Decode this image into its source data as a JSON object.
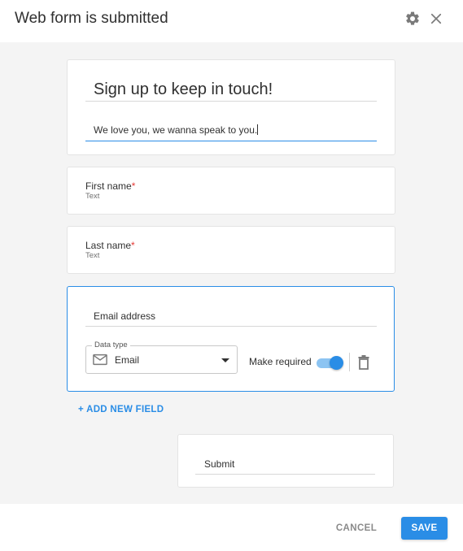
{
  "header": {
    "title": "Web form is submitted",
    "icons": {
      "settings": "gear-icon",
      "close": "close-icon"
    }
  },
  "form": {
    "title": "Sign up to keep in touch!",
    "description": "We love you, we wanna speak to you."
  },
  "fields": [
    {
      "label": "First name",
      "required_mark": "*",
      "type": "Text"
    },
    {
      "label": "Last name",
      "required_mark": "*",
      "type": "Text"
    }
  ],
  "active_field": {
    "label": "Email address",
    "data_type_legend": "Data type",
    "data_type_value": "Email",
    "data_type_icon": "mail-icon",
    "make_required_label": "Make required",
    "make_required_on": true,
    "delete_icon": "trash-icon"
  },
  "add_field_label": "+ ADD NEW FIELD",
  "submit_button_label": "Submit",
  "footer": {
    "cancel_label": "CANCEL",
    "save_label": "SAVE"
  },
  "colors": {
    "accent": "#2a8de6",
    "required": "#e53935",
    "background": "#f4f4f4"
  }
}
